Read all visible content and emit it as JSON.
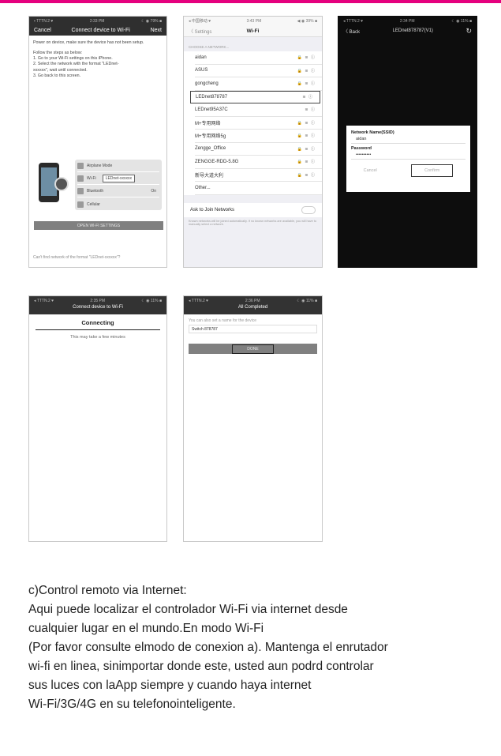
{
  "phone1": {
    "status_left": "▪ TTTN.2 ♥",
    "status_time": "2:33 PM",
    "status_right": "☾ ◉ 79% ■",
    "cancel": "Cancel",
    "title": "Connect device to Wi-Fi",
    "next": "Next",
    "para1": "Power on device, make sure the device has not been setup.",
    "para2_l1": "Follow the steps as below:",
    "para2_l2": "1. Go to your Wi-Fi settings on this iPhone.",
    "para2_l3": "2. Select the network with the format \"LEDnet-",
    "para2_l4": "xxxxxx\", wait until connected.",
    "para2_l5": "3. Go back to this screen.",
    "panel_row1": "Airplane Mode",
    "panel_row2": "Wi-Fi",
    "panel_pill": "LEDnet-xxxxxx",
    "panel_row3": "Bluetooth",
    "panel_row3_val": "On",
    "panel_row4": "Cellular",
    "open_button": "OPEN WI-FI SETTINGS",
    "footer": "Can't find network of the format \"LEDnet-xxxxxx\"?"
  },
  "phone2": {
    "status_left": "◂ 中国移动 ♥",
    "status_time": "3:43 PM",
    "status_right": "◀ ◉ 39% ■",
    "back": "〈 Settings",
    "title": "Wi-Fi",
    "section": "CHOOSE A NETWORK...",
    "networks": [
      {
        "name": "aidan",
        "icons": "🔒 ≋ ⓘ"
      },
      {
        "name": "ASUS",
        "icons": "🔒 ≋ ⓘ"
      },
      {
        "name": "gongcheng",
        "icons": "🔒 ≋ ⓘ"
      },
      {
        "name": "LEDnet878787",
        "icons": "≋ ⓘ"
      },
      {
        "name": "LEDnet95A37C",
        "icons": "≋ ⓘ"
      },
      {
        "name": "M+专用网络",
        "icons": "🔒 ≋ ⓘ"
      },
      {
        "name": "M+专用网络5g",
        "icons": "🔒 ≋ ⓘ"
      },
      {
        "name": "Zengge_Office",
        "icons": "🔒 ≋ ⓘ"
      },
      {
        "name": "ZENGGE-RDD-5.8G",
        "icons": "🔒 ≋ ⓘ"
      },
      {
        "name": "新导大道大利",
        "icons": "🔒 ≋ ⓘ"
      },
      {
        "name": "Other...",
        "icons": ""
      }
    ],
    "ask": "Ask to Join Networks",
    "note": "Known networks will be joined automatically. If no known networks are available, you will have to manually select a network."
  },
  "phone3": {
    "status_left": "◂ TTTN.2 ♥",
    "status_time": "2:34 PM",
    "status_right": "☾ ◉ 11% ■",
    "back": "〈 Back",
    "title": "LEDnet878787(V1)",
    "refresh": "↻",
    "ssid_label": "Network Name(SSID)",
    "ssid_value": "aidan",
    "pwd_label": "Password",
    "pwd_value": "••••••••••",
    "cancel": "Cancel",
    "confirm": "Confirm"
  },
  "phone4": {
    "status_left": "◂ TTTN.2 ♥",
    "status_time": "2:35 PM",
    "status_right": "☾ ◉ 11% ■",
    "title": "Connect device to Wi-Fi",
    "heading": "Connecting",
    "sub": "This may take a few minutes"
  },
  "phone5": {
    "status_left": "◂ TTTN.2 ♥",
    "status_time": "2:36 PM",
    "status_right": "☾ ◉ 11% ■",
    "title": "All Completed",
    "hint": "You can also set a name for the device",
    "name_value": "Switch 878787",
    "done": "DONE"
  },
  "text": {
    "line1": "c)Control remoto via Internet:",
    "line2": "Aqui puede localizar el controlador Wi-Fi via internet desde",
    "line3": "cualquier lugar en el mundo.En modo Wi-Fi",
    "line4": "(Por favor consulte elmodo de conexion a). Mantenga el enrutador",
    "line5": "wi-fi en linea, sinimportar donde este, usted aun podrd controlar",
    "line6": "sus luces con laApp siempre y cuando haya internet",
    "line7": "Wi-Fi/3G/4G en su telefonointeligente."
  }
}
